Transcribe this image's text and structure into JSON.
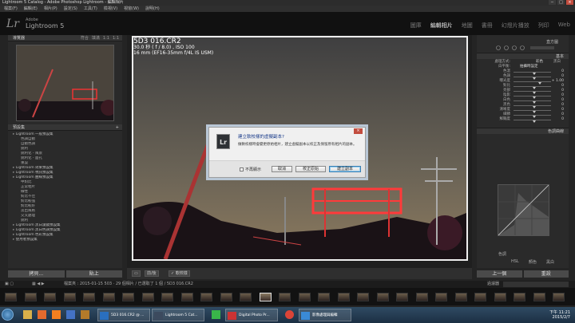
{
  "window": {
    "title": "Lightroom 5 Catalog - Adobe Photoshop Lightroom - 編輯相片"
  },
  "menu": [
    "檔案(F)",
    "編輯(E)",
    "相片(P)",
    "設定(S)",
    "工具(T)",
    "檢視(V)",
    "視窗(W)",
    "說明(H)"
  ],
  "identity": {
    "logo": "Lr",
    "brand": "Adobe",
    "product": "Lightroom 5"
  },
  "modules": [
    "圖庫",
    "編輯相片",
    "地圖",
    "書冊",
    "幻燈片播放",
    "列印",
    "Web"
  ],
  "navigator": {
    "title": "導覽器",
    "tabs": [
      "符合",
      "填滿",
      "1:1",
      "1:1"
    ]
  },
  "presets": {
    "title": "預設集",
    "items": [
      {
        "label": "Lightroom 一般預設集",
        "type": "group"
      },
      {
        "label": "色調自動",
        "type": "sub"
      },
      {
        "label": "自動色調",
        "type": "sub"
      },
      {
        "label": "銳利",
        "type": "sub"
      },
      {
        "label": "銳利化 - 風景",
        "type": "sub"
      },
      {
        "label": "銳利化 - 面孔",
        "type": "sub"
      },
      {
        "label": "重設",
        "type": "sub"
      },
      {
        "label": "Lightroom 效果預設集",
        "type": "group"
      },
      {
        "label": "Lightroom 視訊預設集",
        "type": "group"
      },
      {
        "label": "Lightroom 曲線預設集",
        "type": "group"
      },
      {
        "label": "中對比",
        "type": "sub"
      },
      {
        "label": "正常相片",
        "type": "sub"
      },
      {
        "label": "線性",
        "type": "sub"
      },
      {
        "label": "對比不佳",
        "type": "sub"
      },
      {
        "label": "對比較強",
        "type": "sub"
      },
      {
        "label": "對比較好",
        "type": "sub"
      },
      {
        "label": "淡出風格",
        "type": "sub"
      },
      {
        "label": "交叉處理",
        "type": "sub"
      },
      {
        "label": "銳利",
        "type": "sub"
      },
      {
        "label": "Lightroom 黑白濾鏡預設集",
        "type": "group"
      },
      {
        "label": "Lightroom 黑白色調預設集",
        "type": "group"
      },
      {
        "label": "Lightroom 色彩預設集",
        "type": "group"
      },
      {
        "label": "使用者預設集",
        "type": "group"
      }
    ]
  },
  "leftButtons": {
    "copy": "拷貝...",
    "paste": "貼上"
  },
  "photo": {
    "filename": "5D3 016.CR2",
    "exposure": "30.0 秒 ( f / 8.0) , ISO 100",
    "lens": "16 mm (EF16-35mm f/4L IS USM)"
  },
  "dialog": {
    "title": "建立軟校樣的虛擬副本?",
    "message": "做軟校樣時會變更原始相片，建立虛擬副本以校正及保留原有相片的副本。",
    "dontshow": "不再顯示",
    "buttons": [
      "取消",
      "校正原始",
      "建立副本"
    ]
  },
  "rightPanel": {
    "histogramLabel": "直方圖",
    "basicTitle": "基本",
    "treatment": "處理方式:",
    "treatmentOptions": [
      "彩色",
      "黑白"
    ],
    "wbLabel": "白平衡:",
    "wbValue": "拍攝時設定",
    "sliders": [
      {
        "label": "色溫",
        "value": "0",
        "pos": 0.5
      },
      {
        "label": "色調",
        "value": "0",
        "pos": 0.5
      },
      {
        "label": "曝光度",
        "value": "+ 1.00",
        "pos": 0.65
      },
      {
        "label": "對比",
        "value": "0",
        "pos": 0.5
      },
      {
        "label": "亮部",
        "value": "0",
        "pos": 0.5
      },
      {
        "label": "陰影",
        "value": "0",
        "pos": 0.5
      },
      {
        "label": "白色",
        "value": "0",
        "pos": 0.5
      },
      {
        "label": "黑色",
        "value": "0",
        "pos": 0.5
      },
      {
        "label": "清晰度",
        "value": "0",
        "pos": 0.5
      },
      {
        "label": "細節",
        "value": "0",
        "pos": 0.5
      },
      {
        "label": "鮮豔度",
        "value": "0",
        "pos": 0.5
      }
    ],
    "toneCurveTitle": "色調曲線",
    "toneLabel": "色調",
    "hsl": [
      "HSL",
      "顏色",
      "黑白"
    ],
    "buttons": [
      "上一個",
      "重設"
    ]
  },
  "toolbar": {
    "before": "前/後",
    "proof": "軟校樣"
  },
  "filmstrip": {
    "info": "檔案夾 : 2015-01-15 503 · 29 個相片 / 已選取了 1 個 / 5D3 016.CR2",
    "filter": "過濾器"
  },
  "taskbar": {
    "apps": [
      "5D3 016.CR2 @ ...",
      "Lightroom 5 Cat...",
      "Digital Photo Pr...",
      "影像處理與編輯"
    ],
    "time": "下午 11:21",
    "date": "2015/2/7"
  },
  "colors": {
    "accent": "#d65050",
    "panel": "#2a2a2a",
    "dialogBorder": "#b9c7d6"
  }
}
